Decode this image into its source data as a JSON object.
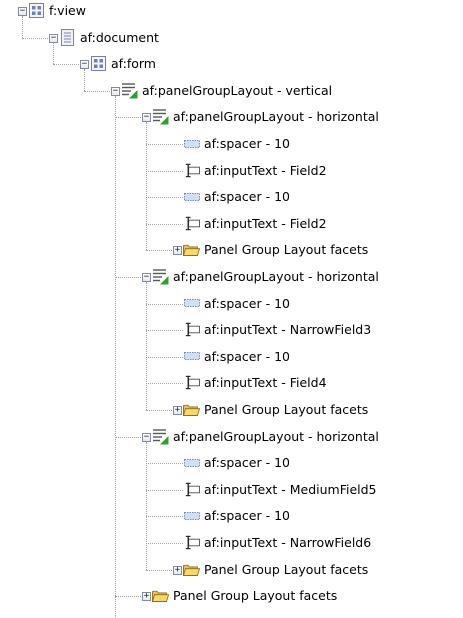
{
  "tree": {
    "nodes": [
      {
        "level": 0,
        "label": "f:view",
        "icon": "view-icon",
        "toggle": "minus"
      },
      {
        "level": 1,
        "label": "af:document",
        "icon": "document-icon",
        "toggle": "minus"
      },
      {
        "level": 2,
        "label": "af:form",
        "icon": "form-icon",
        "toggle": "minus"
      },
      {
        "level": 3,
        "label": "af:panelGroupLayout - vertical",
        "icon": "panel-group-layout-icon",
        "toggle": "minus"
      },
      {
        "level": 4,
        "label": "af:panelGroupLayout - horizontal",
        "icon": "panel-group-layout-icon",
        "toggle": "minus"
      },
      {
        "level": 5,
        "label": "af:spacer - 10",
        "icon": "spacer-icon",
        "toggle": null
      },
      {
        "level": 5,
        "label": "af:inputText - Field2",
        "icon": "input-text-icon",
        "toggle": null
      },
      {
        "level": 5,
        "label": "af:spacer - 10",
        "icon": "spacer-icon",
        "toggle": null
      },
      {
        "level": 5,
        "label": "af:inputText - Field2",
        "icon": "input-text-icon",
        "toggle": null
      },
      {
        "level": 5,
        "label": "Panel Group Layout facets",
        "icon": "folder-icon",
        "toggle": "plus"
      },
      {
        "level": 4,
        "label": "af:panelGroupLayout - horizontal",
        "icon": "panel-group-layout-icon",
        "toggle": "minus"
      },
      {
        "level": 5,
        "label": "af:spacer - 10",
        "icon": "spacer-icon",
        "toggle": null
      },
      {
        "level": 5,
        "label": "af:inputText - NarrowField3",
        "icon": "input-text-icon",
        "toggle": null
      },
      {
        "level": 5,
        "label": "af:spacer - 10",
        "icon": "spacer-icon",
        "toggle": null
      },
      {
        "level": 5,
        "label": "af:inputText - Field4",
        "icon": "input-text-icon",
        "toggle": null
      },
      {
        "level": 5,
        "label": "Panel Group Layout facets",
        "icon": "folder-icon",
        "toggle": "plus"
      },
      {
        "level": 4,
        "label": "af:panelGroupLayout - horizontal",
        "icon": "panel-group-layout-icon",
        "toggle": "minus"
      },
      {
        "level": 5,
        "label": "af:spacer - 10",
        "icon": "spacer-icon",
        "toggle": null
      },
      {
        "level": 5,
        "label": "af:inputText - MediumField5",
        "icon": "input-text-icon",
        "toggle": null
      },
      {
        "level": 5,
        "label": "af:spacer - 10",
        "icon": "spacer-icon",
        "toggle": null
      },
      {
        "level": 5,
        "label": "af:inputText - NarrowField6",
        "icon": "input-text-icon",
        "toggle": null
      },
      {
        "level": 5,
        "label": "Panel Group Layout facets",
        "icon": "folder-icon",
        "toggle": "plus"
      },
      {
        "level": 4,
        "label": "Panel Group Layout facets",
        "icon": "folder-icon",
        "toggle": "plus"
      }
    ]
  },
  "colors": {
    "tree_line": "#a0a0a0",
    "panel_icon_accent": "#2ea02e",
    "folder": "#e8c44a"
  }
}
